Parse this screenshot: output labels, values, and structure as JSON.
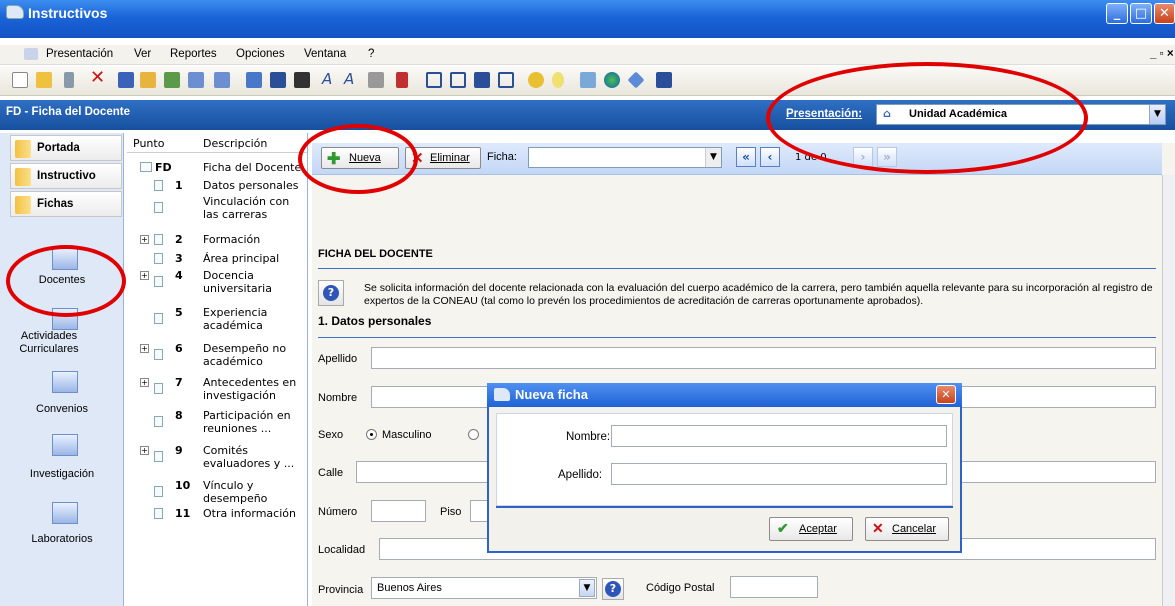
{
  "window": {
    "title": "Instructivos"
  },
  "menu": [
    "Presentación",
    "Ver",
    "Reportes",
    "Opciones",
    "Ventana",
    "?"
  ],
  "header": {
    "form_title": "FD - Ficha del Docente",
    "presentation_label": "Presentación:",
    "presentation_value": "Unidad Académica"
  },
  "leftnav": {
    "buttons": [
      "Portada",
      "Instructivo",
      "Fichas"
    ],
    "items": [
      "Docentes",
      "Actividades Curriculares",
      "Convenios",
      "Investigación",
      "Laboratorios"
    ]
  },
  "tree": {
    "col_punto": "Punto",
    "col_desc": "Descripción",
    "rows": [
      {
        "num": "FD",
        "desc": "Ficha del Docente"
      },
      {
        "num": "1",
        "desc": "Datos personales"
      },
      {
        "num": "",
        "desc": "Vinculación con las carreras"
      },
      {
        "num": "2",
        "desc": "Formación"
      },
      {
        "num": "3",
        "desc": "Área principal"
      },
      {
        "num": "4",
        "desc": "Docencia universitaria"
      },
      {
        "num": "5",
        "desc": "Experiencia académica"
      },
      {
        "num": "6",
        "desc": "Desempeño no académico"
      },
      {
        "num": "7",
        "desc": "Antecedentes en investigación"
      },
      {
        "num": "8",
        "desc": "Participación en reuniones ..."
      },
      {
        "num": "9",
        "desc": "Comités evaluadores y ..."
      },
      {
        "num": "10",
        "desc": "Vínculo y desempeño"
      },
      {
        "num": "11",
        "desc": "Otra información"
      }
    ]
  },
  "toolbar2": {
    "new_label": "Nueva",
    "delete_label": "Eliminar",
    "ficha_label": "Ficha:",
    "page_counter": "1 de 0"
  },
  "form": {
    "title": "FICHA DEL DOCENTE",
    "info": "Se solicita información del docente relacionada con la evaluación del cuerpo académico de la carrera, pero también aquella relevante para su incorporación al registro de expertos de la CONEAU (tal como lo prevén los procedimientos de acreditación de carreras oportunamente aprobados).",
    "section1": "1. Datos personales",
    "apellido": "Apellido",
    "nombre": "Nombre",
    "sexo": "Sexo",
    "masculino": "Masculino",
    "calle": "Calle",
    "numero": "Número",
    "piso": "Piso",
    "localidad": "Localidad",
    "provincia": "Provincia",
    "provincia_value": "Buenos Aires",
    "codigo_postal": "Código Postal"
  },
  "dialog": {
    "title": "Nueva ficha",
    "nombre_label": "Nombre:",
    "apellido_label": "Apellido:",
    "accept": "Aceptar",
    "cancel": "Cancelar"
  }
}
